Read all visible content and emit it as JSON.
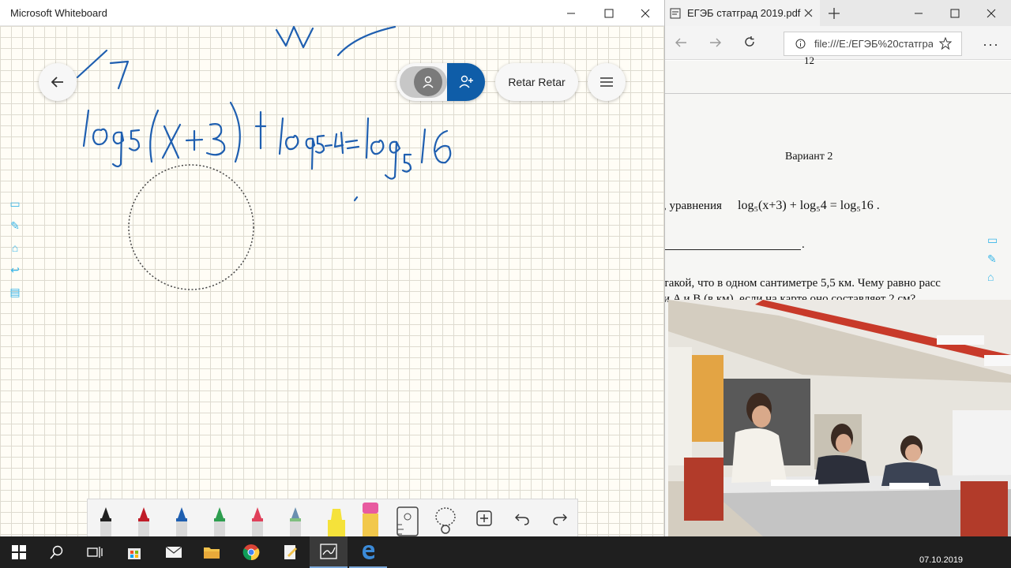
{
  "whiteboard": {
    "window_title": "Microsoft Whiteboard",
    "user_button_label": "Retar Retar",
    "handwriting": {
      "number": "7",
      "equation": "log₅(x+3) + log₅4 = log₅16"
    }
  },
  "edge": {
    "tab_title": "ЕГЭБ статград 2019.pdf",
    "url": "file:///E:/ЕГЭБ%20статгра,",
    "page": {
      "page_number": "12",
      "variant_heading": "Вариант 2",
      "equation_line_prefix": ", уравнения",
      "equation_line_math": "log₅(x+3) + log₅4 = log₅16 .",
      "answer_blank": ".",
      "problem_text_1": "такой, что в одном сантиметре 5,5 км. Чему равно расс",
      "problem_text_2": "и A и B (в км), если на карте оно составляет 2 см?"
    }
  },
  "taskbar": {
    "date": "07.10.2019"
  },
  "colors": {
    "ink": "#1f5fb0",
    "accent": "#0f5da8",
    "grid_line": "#dedbd0"
  }
}
